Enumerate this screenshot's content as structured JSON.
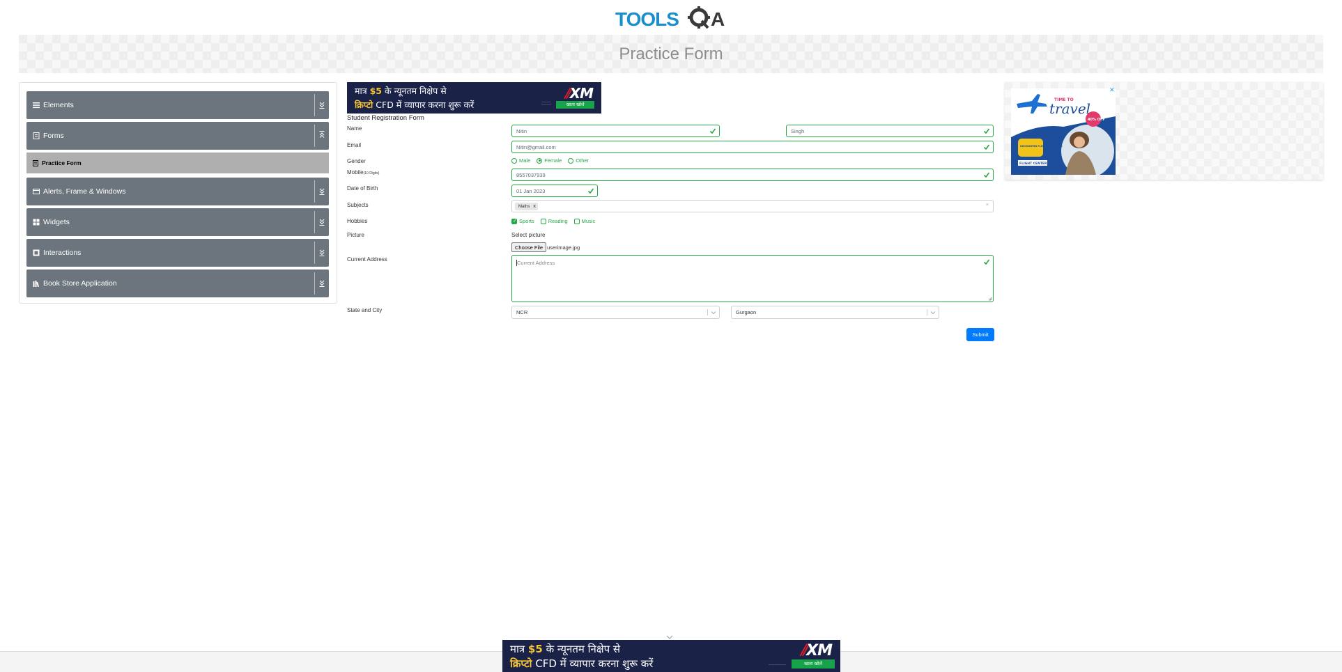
{
  "page": {
    "title": "Practice Form",
    "logo_text": "TOOLSQA"
  },
  "sidebar": {
    "groups": [
      {
        "label": "Elements",
        "icon": "menu-lines-icon"
      },
      {
        "label": "Forms",
        "icon": "document-icon"
      },
      {
        "label": "Alerts, Frame & Windows",
        "icon": "window-icon"
      },
      {
        "label": "Widgets",
        "icon": "grid-icon"
      },
      {
        "label": "Interactions",
        "icon": "square-icon"
      },
      {
        "label": "Book Store Application",
        "icon": "books-icon"
      }
    ],
    "active_item": "Practice Form"
  },
  "ads": {
    "xm": {
      "line1_a": "मात्र",
      "line1_amount": "$5",
      "line1_b": "के न्यूनतम निक्षेप से",
      "line2_a": "क्रिप्टो",
      "line2_b": "CFD में  व्यापार करना शुरू करें",
      "brand": "XM",
      "button": "खाता खोलें"
    },
    "travel": {
      "headline_small": "TIME TO",
      "headline": "travel",
      "badge": "40% OFF",
      "tag": "DISCOUNTED FLIGHTS & HOTELS",
      "brand": "FLIGHT CENTER",
      "close": "✕"
    }
  },
  "form": {
    "title": "Student Registration Form",
    "labels": {
      "name": "Name",
      "email": "Email",
      "gender": "Gender",
      "mobile": "Mobile",
      "mobile_hint": "(10 Digits)",
      "dob": "Date of Birth",
      "subjects": "Subjects",
      "hobbies": "Hobbies",
      "picture": "Picture",
      "address": "Current Address",
      "state_city": "State and City"
    },
    "first_name": "Nitin",
    "last_name": "Singh",
    "email": "Nitin@gmail.com",
    "gender_options": [
      "Male",
      "Female",
      "Other"
    ],
    "gender_selected": "Female",
    "mobile": "8557037939",
    "dob": "01 Jan 2023",
    "subjects": [
      "Maths"
    ],
    "subjects_remove": "x",
    "subjects_clear": "×",
    "hobbies": [
      {
        "label": "Sports",
        "checked": true
      },
      {
        "label": "Reading",
        "checked": false
      },
      {
        "label": "Music",
        "checked": false
      }
    ],
    "picture_prompt": "Select picture",
    "choose_file": "Choose File",
    "file_name": "userimage.jpg",
    "address_placeholder": "Current Address",
    "state": "NCR",
    "city": "Gurgaon",
    "submit": "Submit"
  },
  "colors": {
    "valid": "#28a745",
    "sidebar": "#6c757d",
    "sidebar_active": "#afafaf",
    "primary": "#007bff"
  }
}
